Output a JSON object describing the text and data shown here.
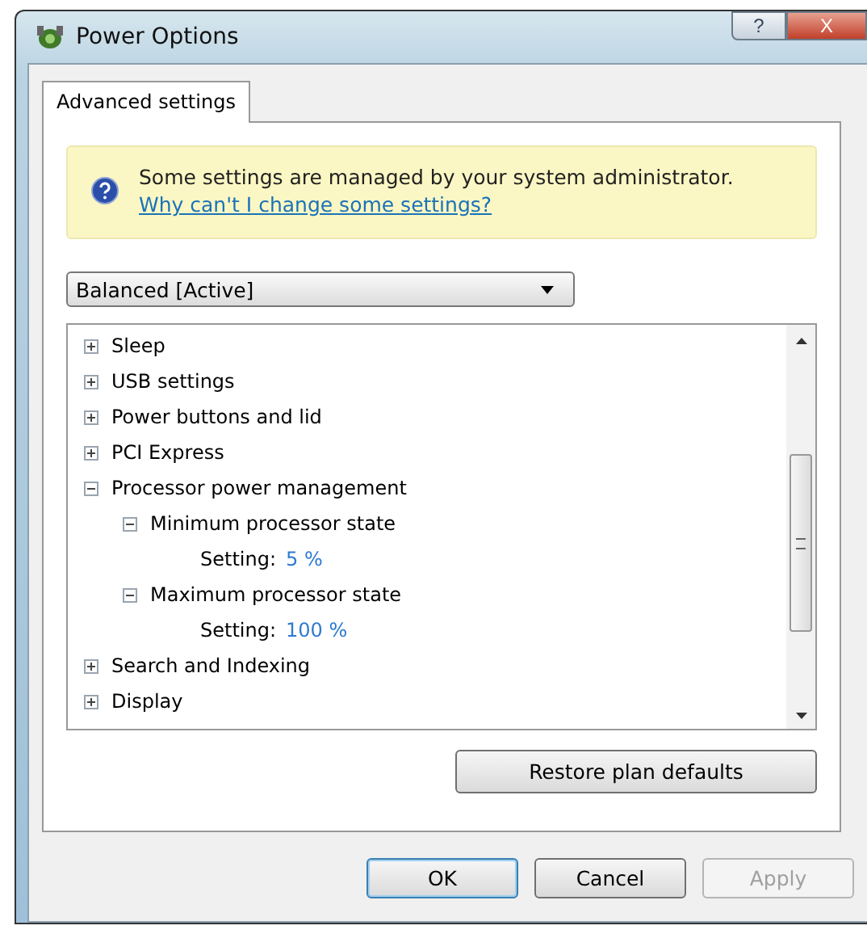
{
  "window": {
    "title": "Power Options"
  },
  "title_buttons": [
    {
      "kind": "help",
      "label": "?"
    },
    {
      "kind": "close",
      "label": "X"
    }
  ],
  "tabs": [
    {
      "label": "Advanced settings",
      "selected": true
    }
  ],
  "notice": {
    "text": "Some settings are managed by your system administrator.",
    "link": "Why can't I change some settings?"
  },
  "plan_dropdown": {
    "value": "Balanced [Active]"
  },
  "tree": [
    {
      "label": "Sleep",
      "expanded": false
    },
    {
      "label": "USB settings",
      "expanded": false
    },
    {
      "label": "Power buttons and lid",
      "expanded": false
    },
    {
      "label": "PCI Express",
      "expanded": false
    },
    {
      "label": "Processor power management",
      "expanded": true,
      "children": [
        {
          "label": "Minimum processor state",
          "expanded": true,
          "setting": {
            "label": "Setting:",
            "value": "5 %"
          }
        },
        {
          "label": "Maximum processor state",
          "expanded": true,
          "setting": {
            "label": "Setting:",
            "value": "100 %"
          }
        }
      ]
    },
    {
      "label": "Search and Indexing",
      "expanded": false
    },
    {
      "label": "Display",
      "expanded": false
    }
  ],
  "restore_button": "Restore plan defaults",
  "buttons": [
    {
      "label": "OK",
      "disabled": false,
      "default": true
    },
    {
      "label": "Cancel",
      "disabled": false,
      "default": false
    },
    {
      "label": "Apply",
      "disabled": true,
      "default": false
    }
  ]
}
